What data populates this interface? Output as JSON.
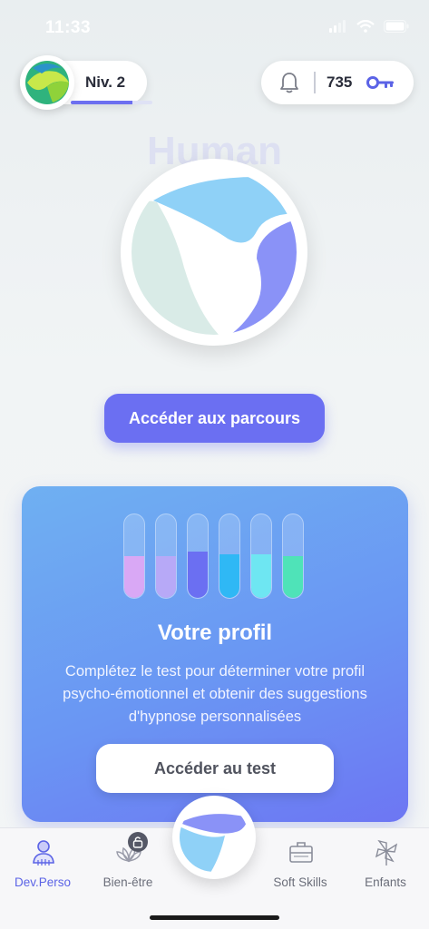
{
  "status": {
    "time": "11:33"
  },
  "header": {
    "level_label": "Niv. 2",
    "level_progress": 0.75,
    "keys_count": "735"
  },
  "hero": {
    "watermark": "Human"
  },
  "cta": {
    "parcours_label": "Accéder aux parcours"
  },
  "profile_card": {
    "title": "Votre profil",
    "description": "Complétez le test pour déterminer votre profil psycho-émotionnel et obtenir des suggestions d'hypnose personnalisées",
    "button_label": "Accéder au test",
    "tubes": [
      {
        "color": "#d9a8f5",
        "level": 0.5
      },
      {
        "color": "#b7a9f7",
        "level": 0.5
      },
      {
        "color": "#6b6ff2",
        "level": 0.55
      },
      {
        "color": "#2fb8f5",
        "level": 0.52
      },
      {
        "color": "#6ee6f2",
        "level": 0.52
      },
      {
        "color": "#4fe3b8",
        "level": 0.5
      }
    ]
  },
  "tabbar": {
    "tabs": [
      {
        "label": "Dev.Perso",
        "icon": "person-icon",
        "active": true
      },
      {
        "label": "Bien-être",
        "icon": "lotus-icon",
        "active": false
      },
      {
        "label": "Soft Skills",
        "icon": "briefcase-icon",
        "active": false
      },
      {
        "label": "Enfants",
        "icon": "pinwheel-icon",
        "active": false
      }
    ]
  },
  "colors": {
    "accent": "#6b6ff2",
    "card_top": "#6fb0f2",
    "card_bottom": "#6d76f3"
  }
}
